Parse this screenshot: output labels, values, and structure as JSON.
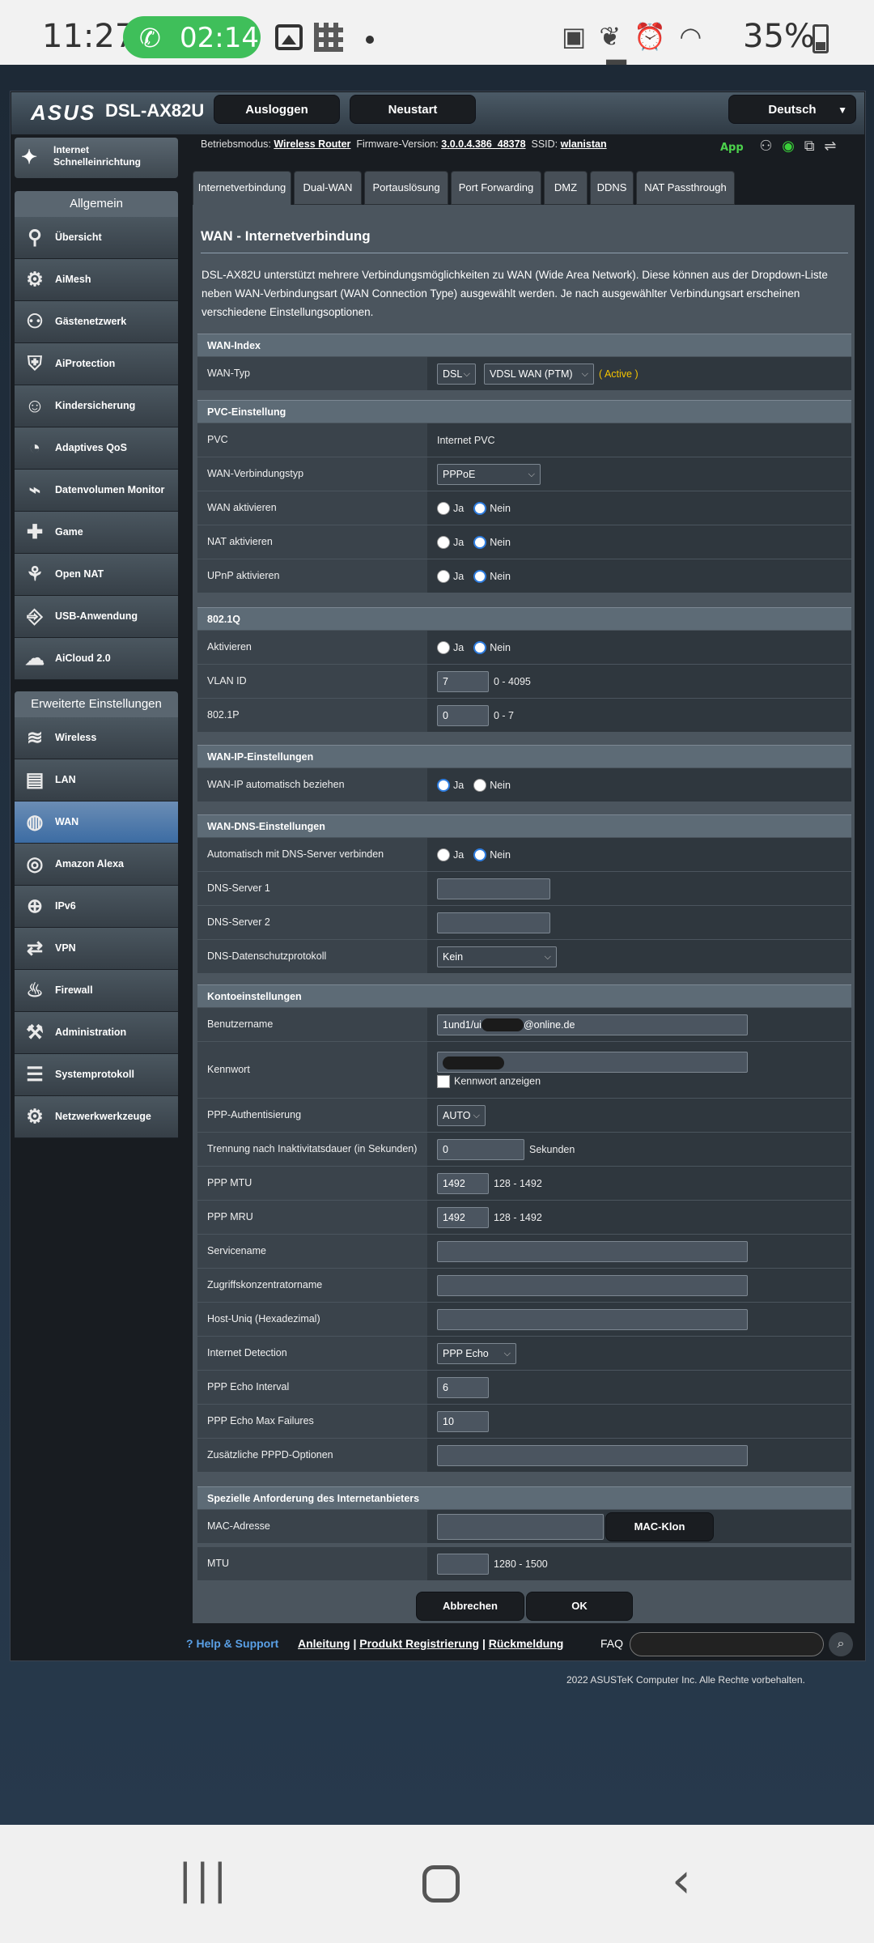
{
  "statusbar": {
    "time": "11:27",
    "call_timer": "02:14",
    "battery_pct": "35%"
  },
  "header": {
    "logo": "ASUS",
    "model": "DSL-AX82U",
    "logout": "Ausloggen",
    "reboot": "Neustart",
    "language": "Deutsch"
  },
  "infobar": {
    "mode_label": "Betriebsmodus:",
    "mode_value": "Wireless Router",
    "fw_label": "Firmware-Version:",
    "fw_value": "3.0.0.4.386_48378",
    "ssid_label": "SSID:",
    "ssid_value": "wlanistan",
    "app": "App"
  },
  "sidebar": {
    "quick": "Internet Schnelleinrichtung",
    "general_head": "Allgemein",
    "general": [
      {
        "label": "Übersicht",
        "icon": "overview-icon"
      },
      {
        "label": "AiMesh",
        "icon": "aimesh-icon"
      },
      {
        "label": "Gästenetzwerk",
        "icon": "guest-network-icon"
      },
      {
        "label": "AiProtection",
        "icon": "shield-icon"
      },
      {
        "label": "Kindersicherung",
        "icon": "parental-control-icon"
      },
      {
        "label": "Adaptives QoS",
        "icon": "qos-gauge-icon"
      },
      {
        "label": "Datenvolumen Monitor",
        "icon": "traffic-monitor-icon"
      },
      {
        "label": "Game",
        "icon": "gamepad-icon"
      },
      {
        "label": "Open NAT",
        "icon": "open-nat-icon"
      },
      {
        "label": "USB-Anwendung",
        "icon": "usb-icon"
      },
      {
        "label": "AiCloud 2.0",
        "icon": "cloud-icon"
      }
    ],
    "advanced_head": "Erweiterte Einstellungen",
    "advanced": [
      {
        "label": "Wireless",
        "icon": "wireless-icon"
      },
      {
        "label": "LAN",
        "icon": "lan-icon"
      },
      {
        "label": "WAN",
        "icon": "wan-globe-icon"
      },
      {
        "label": "Amazon Alexa",
        "icon": "alexa-icon"
      },
      {
        "label": "IPv6",
        "icon": "ipv6-icon"
      },
      {
        "label": "VPN",
        "icon": "vpn-icon"
      },
      {
        "label": "Firewall",
        "icon": "firewall-icon"
      },
      {
        "label": "Administration",
        "icon": "admin-icon"
      },
      {
        "label": "Systemprotokoll",
        "icon": "syslog-icon"
      },
      {
        "label": "Netzwerkwerkzeuge",
        "icon": "network-tools-icon"
      }
    ]
  },
  "tabs": [
    "Internetverbindung",
    "Dual-WAN",
    "Portauslösung",
    "Port Forwarding",
    "DMZ",
    "DDNS",
    "NAT Passthrough"
  ],
  "page": {
    "title": "WAN - Internetverbindung",
    "desc": "DSL-AX82U unterstützt mehrere Verbindungsmöglichkeiten zu WAN (Wide Area Network). Diese können aus der Dropdown-Liste neben WAN-Verbindungsart (WAN Connection Type) ausgewählt werden. Je nach ausgewählter Verbindungsart erscheinen verschiedene Einstellungsoptionen."
  },
  "yes": "Ja",
  "no": "Nein",
  "sections": {
    "wan_index": {
      "head": "WAN-Index",
      "wan_type_label": "WAN-Typ",
      "dsl": "DSL",
      "mode": "VDSL WAN (PTM)",
      "active": "( Active )"
    },
    "pvc": {
      "head": "PVC-Einstellung",
      "pvc_label": "PVC",
      "pvc_value": "Internet PVC",
      "conn_label": "WAN-Verbindungstyp",
      "conn_value": "PPPoE",
      "wan_enable": "WAN aktivieren",
      "nat_enable": "NAT aktivieren",
      "upnp_enable": "UPnP aktivieren"
    },
    "vlan": {
      "head": "802.1Q",
      "enable": "Aktivieren",
      "vlan_label": "VLAN ID",
      "vlan_value": "7",
      "vlan_range": "0 - 4095",
      "p_label": "802.1P",
      "p_value": "0",
      "p_range": "0 - 7"
    },
    "wanip": {
      "head": "WAN-IP-Einstellungen",
      "auto": "WAN-IP automatisch beziehen"
    },
    "dns": {
      "head": "WAN-DNS-Einstellungen",
      "auto": "Automatisch mit DNS-Server verbinden",
      "dns1": "DNS-Server 1",
      "dns2": "DNS-Server 2",
      "privacy_label": "DNS-Datenschutzprotokoll",
      "privacy_value": "Kein"
    },
    "account": {
      "head": "Kontoeinstellungen",
      "user_label": "Benutzername",
      "user_prefix": "1und1/ui",
      "user_suffix": "@online.de",
      "pass_label": "Kennwort",
      "show_pass": "Kennwort anzeigen",
      "auth_label": "PPP-Authentisierung",
      "auth_value": "AUTO",
      "idle_label": "Trennung nach Inaktivitatsdauer (in Sekunden)",
      "idle_value": "0",
      "idle_unit": "Sekunden",
      "mtu_label": "PPP MTU",
      "mtu_value": "1492",
      "mtu_range": "128 - 1492",
      "mru_label": "PPP MRU",
      "mru_value": "1492",
      "mru_range": "128 - 1492",
      "service_label": "Servicename",
      "ac_label": "Zugriffskonzentratorname",
      "host_label": "Host-Uniq (Hexadezimal)",
      "detect_label": "Internet Detection",
      "detect_value": "PPP Echo",
      "echo_int_label": "PPP Echo Interval",
      "echo_int_value": "6",
      "echo_fail_label": "PPP Echo Max Failures",
      "echo_fail_value": "10",
      "pppd_label": "Zusätzliche PPPD-Optionen"
    },
    "isp": {
      "head": "Spezielle Anforderung des Internetanbieters",
      "mac_label": "MAC-Adresse",
      "mac_clone": "MAC-Klon",
      "mtu_label": "MTU",
      "mtu_range": "1280 - 1500"
    }
  },
  "actions": {
    "cancel": "Abbrechen",
    "ok": "OK"
  },
  "footer": {
    "help": "Help & Support",
    "manual": "Anleitung",
    "register": "Produkt Registrierung",
    "feedback": "Rückmeldung",
    "sep": "|",
    "faq": "FAQ",
    "copyright": "2022 ASUSTeK Computer Inc. Alle Rechte vorbehalten."
  },
  "colors": {
    "accent": "#2e7de0",
    "active_status": "#f5c400",
    "app_green": "#4cd24c",
    "wan_active": "#4a76a8"
  }
}
